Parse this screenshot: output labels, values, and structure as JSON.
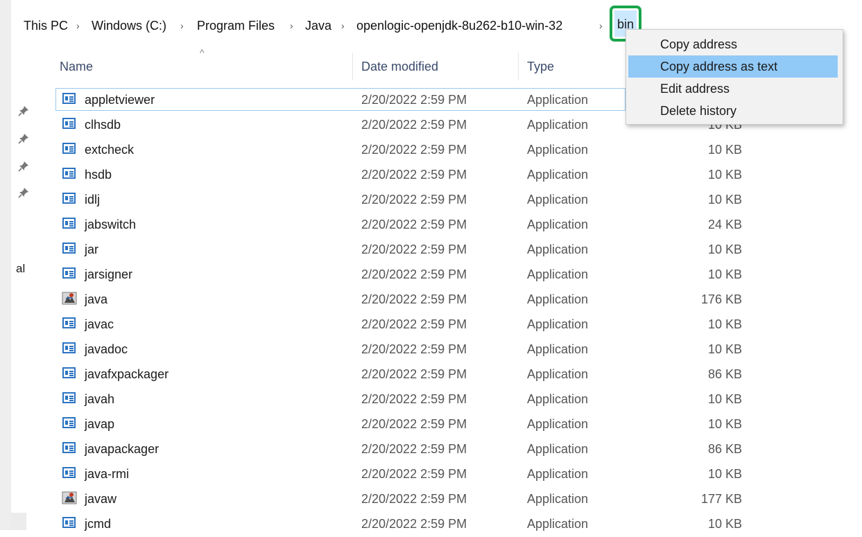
{
  "breadcrumb": [
    "This PC",
    "Windows (C:)",
    "Program Files",
    "Java",
    "openlogic-openjdk-8u262-b10-win-32",
    "bin"
  ],
  "breadcrumb_separator": "›",
  "highlight_color": "#19a44b",
  "columns": {
    "name": "Name",
    "date": "Date modified",
    "type": "Type"
  },
  "sort_indicator": "^",
  "nav": {
    "partial_label": "al",
    "pin_icon": "pin-icon"
  },
  "context_menu": {
    "items": [
      "Copy address",
      "Copy address as text",
      "Edit address",
      "Delete history"
    ],
    "hovered_index": 1
  },
  "files": [
    {
      "name": "appletviewer",
      "date": "2/20/2022 2:59 PM",
      "type": "Application",
      "size": "",
      "icon": "application-icon"
    },
    {
      "name": "clhsdb",
      "date": "2/20/2022 2:59 PM",
      "type": "Application",
      "size": "10 KB",
      "icon": "application-icon"
    },
    {
      "name": "extcheck",
      "date": "2/20/2022 2:59 PM",
      "type": "Application",
      "size": "10 KB",
      "icon": "application-icon"
    },
    {
      "name": "hsdb",
      "date": "2/20/2022 2:59 PM",
      "type": "Application",
      "size": "10 KB",
      "icon": "application-icon"
    },
    {
      "name": "idlj",
      "date": "2/20/2022 2:59 PM",
      "type": "Application",
      "size": "10 KB",
      "icon": "application-icon"
    },
    {
      "name": "jabswitch",
      "date": "2/20/2022 2:59 PM",
      "type": "Application",
      "size": "24 KB",
      "icon": "application-icon"
    },
    {
      "name": "jar",
      "date": "2/20/2022 2:59 PM",
      "type": "Application",
      "size": "10 KB",
      "icon": "application-icon"
    },
    {
      "name": "jarsigner",
      "date": "2/20/2022 2:59 PM",
      "type": "Application",
      "size": "10 KB",
      "icon": "application-icon"
    },
    {
      "name": "java",
      "date": "2/20/2022 2:59 PM",
      "type": "Application",
      "size": "176 KB",
      "icon": "java-icon"
    },
    {
      "name": "javac",
      "date": "2/20/2022 2:59 PM",
      "type": "Application",
      "size": "10 KB",
      "icon": "application-icon"
    },
    {
      "name": "javadoc",
      "date": "2/20/2022 2:59 PM",
      "type": "Application",
      "size": "10 KB",
      "icon": "application-icon"
    },
    {
      "name": "javafxpackager",
      "date": "2/20/2022 2:59 PM",
      "type": "Application",
      "size": "86 KB",
      "icon": "application-icon"
    },
    {
      "name": "javah",
      "date": "2/20/2022 2:59 PM",
      "type": "Application",
      "size": "10 KB",
      "icon": "application-icon"
    },
    {
      "name": "javap",
      "date": "2/20/2022 2:59 PM",
      "type": "Application",
      "size": "10 KB",
      "icon": "application-icon"
    },
    {
      "name": "javapackager",
      "date": "2/20/2022 2:59 PM",
      "type": "Application",
      "size": "86 KB",
      "icon": "application-icon"
    },
    {
      "name": "java-rmi",
      "date": "2/20/2022 2:59 PM",
      "type": "Application",
      "size": "10 KB",
      "icon": "application-icon"
    },
    {
      "name": "javaw",
      "date": "2/20/2022 2:59 PM",
      "type": "Application",
      "size": "177 KB",
      "icon": "java-icon"
    },
    {
      "name": "jcmd",
      "date": "2/20/2022 2:59 PM",
      "type": "Application",
      "size": "10 KB",
      "icon": "application-icon"
    }
  ]
}
